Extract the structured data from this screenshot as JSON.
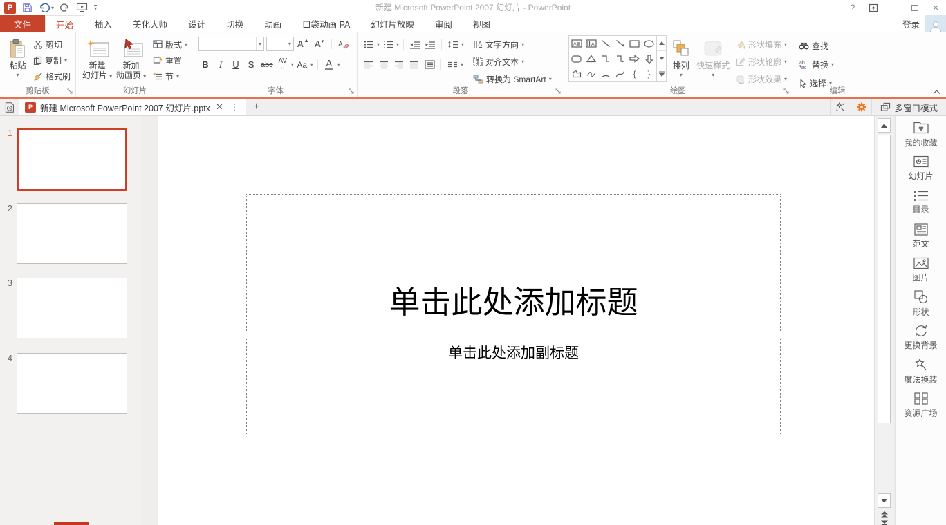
{
  "window": {
    "title": "新建 Microsoft PowerPoint 2007 幻灯片 - PowerPoint",
    "help": "?",
    "login": "登录"
  },
  "menu_tabs": {
    "file": "文件",
    "items": [
      "开始",
      "插入",
      "美化大师",
      "设计",
      "切换",
      "动画",
      "口袋动画 PA",
      "幻灯片放映",
      "审阅",
      "视图"
    ],
    "active": "开始"
  },
  "ribbon": {
    "clipboard": {
      "group": "剪贴板",
      "paste": "粘贴",
      "cut": "剪切",
      "copy": "复制",
      "format_painter": "格式刷"
    },
    "slides": {
      "group": "幻灯片",
      "new_slide_l1": "新建",
      "new_slide_l2": "幻灯片",
      "anim_page_l1": "新加",
      "anim_page_l2": "动画页",
      "layout": "版式",
      "reset": "重置",
      "section": "节"
    },
    "font": {
      "group": "字体",
      "bold": "B",
      "italic": "I",
      "underline": "U",
      "shadow": "S",
      "strike": "abc",
      "spacing": "AV",
      "case": "Aa",
      "color": "A"
    },
    "paragraph": {
      "group": "段落",
      "text_direction": "文字方向",
      "align_text": "对齐文本",
      "smartart": "转换为 SmartArt"
    },
    "drawing": {
      "group": "绘图",
      "arrange": "排列",
      "quick_styles": "快速样式",
      "fill": "形状填充",
      "outline": "形状轮廓",
      "effects": "形状效果"
    },
    "editing": {
      "group": "编辑",
      "find": "查找",
      "replace": "替换",
      "select": "选择"
    }
  },
  "tabbar": {
    "doc_title": "新建 Microsoft PowerPoint 2007 幻灯片.pptx",
    "multi_window": "多窗口模式"
  },
  "thumbnails": [
    {
      "number": "1",
      "selected": true
    },
    {
      "number": "2",
      "selected": false
    },
    {
      "number": "3",
      "selected": false
    },
    {
      "number": "4",
      "selected": false
    }
  ],
  "slide": {
    "title_placeholder": "单击此处添加标题",
    "subtitle_placeholder": "单击此处添加副标题"
  },
  "sidebar": [
    {
      "label": "我的收藏"
    },
    {
      "label": "幻灯片"
    },
    {
      "label": "目录"
    },
    {
      "label": "范文"
    },
    {
      "label": "图片"
    },
    {
      "label": "形状"
    },
    {
      "label": "更换背景"
    },
    {
      "label": "魔法换装"
    },
    {
      "label": "资源广场"
    }
  ],
  "colors": {
    "accent_red": "#C8432B",
    "tabbar_accent_line": "#E5714F",
    "gear_orange": "#E87722",
    "selected_thumb_border": "#CC4125"
  }
}
